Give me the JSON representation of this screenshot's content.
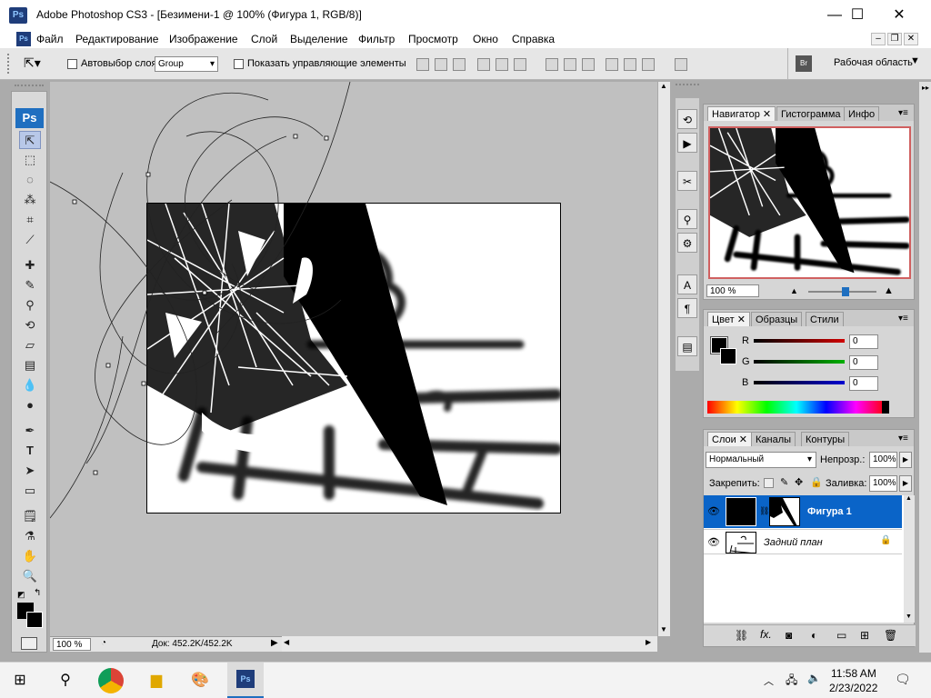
{
  "window": {
    "title": "Adobe Photoshop CS3 - [Безимени-1 @ 100% (Фигура 1, RGB/8)]",
    "app_icon": "Ps",
    "minimize": "—",
    "maximize": "☐",
    "close": "✕"
  },
  "menu": {
    "items": [
      "Файл",
      "Редактирование",
      "Изображение",
      "Слой",
      "Выделение",
      "Фильтр",
      "Просмотр",
      "Окно",
      "Справка"
    ]
  },
  "options_bar": {
    "auto_select_label": "Автовыбор слоя",
    "auto_select_value": "Group",
    "show_controls_label": "Показать управляющие элементы",
    "workspace_label": "Рабочая область"
  },
  "toolbox": {
    "badge": "Ps",
    "tools": [
      "move",
      "marquee",
      "lasso",
      "magic-wand",
      "crop",
      "slice",
      "healing",
      "brush",
      "stamp",
      "history-brush",
      "eraser",
      "gradient",
      "blur",
      "dodge",
      "pen",
      "type",
      "path-select",
      "shape",
      "notes",
      "eyedropper",
      "hand",
      "zoom"
    ]
  },
  "document": {
    "zoom": "100 %",
    "doc_info": "Док: 452.2K/452.2K"
  },
  "navigator": {
    "tabs": [
      "Навигатор",
      "Гистограмма",
      "Инфо"
    ],
    "zoom": "100 %",
    "zoom_level": 0.55
  },
  "color": {
    "tabs": [
      "Цвет",
      "Образцы",
      "Стили"
    ],
    "channels": [
      {
        "label": "R",
        "value": "0",
        "color": "#d00000"
      },
      {
        "label": "G",
        "value": "0",
        "color": "#00b000"
      },
      {
        "label": "B",
        "value": "0",
        "color": "#0000d0"
      }
    ]
  },
  "layers": {
    "tabs": [
      "Слои",
      "Каналы",
      "Контуры"
    ],
    "blend_mode": "Нормальный",
    "opacity_label": "Непрозр.:",
    "opacity": "100%",
    "lock_label": "Закрепить:",
    "fill_label": "Заливка:",
    "fill": "100%",
    "items": [
      {
        "name": "Фигура 1",
        "selected": true
      },
      {
        "name": "Задний план",
        "selected": false
      }
    ],
    "selected_color": "#0a64c8"
  },
  "taskbar": {
    "time": "11:58 AM",
    "date": "2/23/2022"
  }
}
